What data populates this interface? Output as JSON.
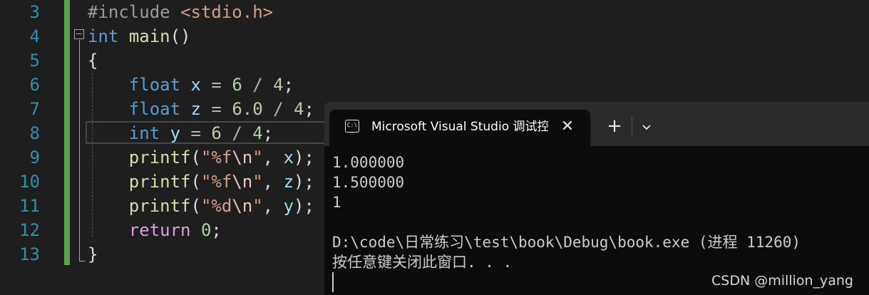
{
  "editor": {
    "line_numbers": [
      "3",
      "4",
      "5",
      "6",
      "7",
      "8",
      "9",
      "10",
      "11",
      "12",
      "13"
    ],
    "lines": {
      "l3": {
        "pp": "#include",
        "header": "<stdio.h>"
      },
      "l4": {
        "kw": "int",
        "name": "main",
        "parens": "()"
      },
      "l5": {
        "brace": "{"
      },
      "l6": {
        "kw": "float",
        "var": "x",
        "eq": "=",
        "n1": "6",
        "div": "/",
        "n2": "4",
        "semi": ";"
      },
      "l7": {
        "kw": "float",
        "var": "z",
        "eq": "=",
        "n1": "6.0",
        "div": "/",
        "n2": "4",
        "semi": ";"
      },
      "l8": {
        "kw": "int",
        "var": "y",
        "eq": "=",
        "n1": "6",
        "div": "/",
        "n2": "4",
        "semi": ";"
      },
      "l9": {
        "fn": "printf",
        "open": "(",
        "str1": "\"%f",
        "esc": "\\n",
        "str2": "\"",
        "comma": ",",
        "arg": "x",
        "close": ");"
      },
      "l10": {
        "fn": "printf",
        "open": "(",
        "str1": "\"%f",
        "esc": "\\n",
        "str2": "\"",
        "comma": ",",
        "arg": "z",
        "close": ");"
      },
      "l11": {
        "fn": "printf",
        "open": "(",
        "str1": "\"%d",
        "esc": "\\n",
        "str2": "\"",
        "comma": ",",
        "arg": "y",
        "close": ");"
      },
      "l12": {
        "kw": "return",
        "n": "0",
        "semi": ";"
      },
      "l13": {
        "brace": "}"
      }
    }
  },
  "terminal": {
    "tab_title": "Microsoft Visual Studio 调试控制台",
    "icon_text": "C:\\",
    "close_label": "✕",
    "new_tab_label": "+",
    "output": [
      "1.000000",
      "1.500000",
      "1",
      "",
      "D:\\code\\日常练习\\test\\book\\Debug\\book.exe (进程 11260)",
      "按任意键关闭此窗口. . ."
    ]
  },
  "watermark": "CSDN @million_yang",
  "colors": {
    "editor_bg": "#1e1e1e",
    "line_number": "#2b91af",
    "keyword": "#569cd6",
    "function": "#dcdcaa",
    "variable": "#9cdcfe",
    "number": "#b5cea8",
    "string": "#d69d85",
    "terminal_bg": "#0c0c0c",
    "terminal_text": "#cccccc",
    "change_bar": "#57a64a"
  }
}
